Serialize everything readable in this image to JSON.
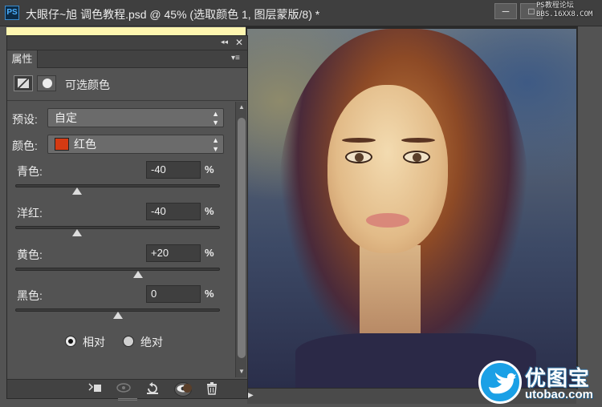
{
  "window": {
    "app_icon": "PS",
    "title": "大眼仔~旭 调色教程.psd @ 45% (选取颜色 1, 图层蒙版/8) *",
    "min_label": "─",
    "max_label": "□"
  },
  "watermark_top": {
    "line1": "PS教程论坛",
    "line2": "BBS.16XX8.COM"
  },
  "panel": {
    "collapse_label": "◂◂",
    "close_label": "✕",
    "tab_label": "属性",
    "tab_menu_label": "▾≡",
    "adjustment_title": "可选颜色",
    "preset_label": "预设:",
    "preset_value": "自定",
    "color_label": "颜色:",
    "color_value": "红色",
    "color_swatch": "#d43a13",
    "sliders": [
      {
        "label": "青色:",
        "value": "-40",
        "unit": "%",
        "level": -40
      },
      {
        "label": "洋红:",
        "value": "-40",
        "unit": "%",
        "level": -40
      },
      {
        "label": "黄色:",
        "value": "+20",
        "unit": "%",
        "level": 20
      },
      {
        "label": "黑色:",
        "value": "0",
        "unit": "%",
        "level": 0
      }
    ],
    "method_relative": "相对",
    "method_absolute": "绝对",
    "method_selected": "相对"
  },
  "bottom_toolbar": {
    "icons": [
      "clip-to-layer-icon",
      "view-previous-icon",
      "reset-icon",
      "visibility-eye-icon",
      "trash-icon"
    ]
  },
  "logo": {
    "text_cn": "优图宝",
    "text_en": "utobao.com"
  }
}
